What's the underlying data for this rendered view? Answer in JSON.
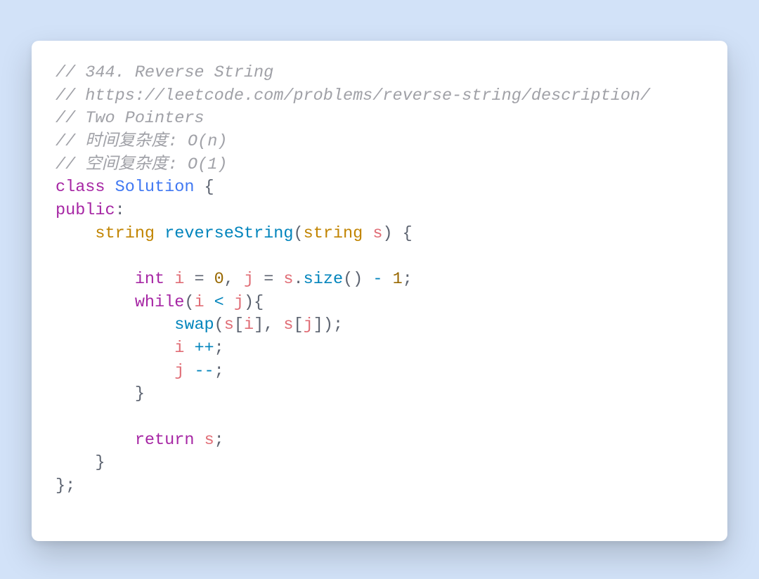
{
  "code": {
    "comment1": "// 344. Reverse String",
    "comment2": "// https://leetcode.com/problems/reverse-string/description/",
    "comment3": "// Two Pointers",
    "comment4": "// 时间复杂度: O(n)",
    "comment5": "// 空间复杂度: O(1)",
    "kw_class": "class",
    "class_name": "Solution",
    "brace_open": " {",
    "kw_public": "public",
    "colon": ":",
    "indent1": "    ",
    "indent2": "        ",
    "indent3": "            ",
    "ret_type": "string",
    "fn_name": "reverseString",
    "fn_open": "(",
    "param_type": "string",
    "param_name": " s",
    "fn_close": ")",
    "fn_body_open": " {",
    "kw_int": "int",
    "var_i": "i",
    "eq": " = ",
    "zero": "0",
    "comma_sp": ", ",
    "var_j": "j",
    "var_s": "s",
    "dot": ".",
    "fn_size": "size",
    "parens": "()",
    "minus_one": " - ",
    "one": "1",
    "semi": ";",
    "kw_while": "while",
    "lparen": "(",
    "lt": " < ",
    "rparen": ")",
    "brace": "{",
    "fn_swap": "swap",
    "lbracket": "[",
    "rbracket": "]",
    "comma": ", ",
    "close_paren_semi": ");",
    "inc": " ++",
    "dec": " --",
    "close_brace": "}",
    "kw_return": "return",
    "return_sp": " ",
    "close_class": "};"
  }
}
